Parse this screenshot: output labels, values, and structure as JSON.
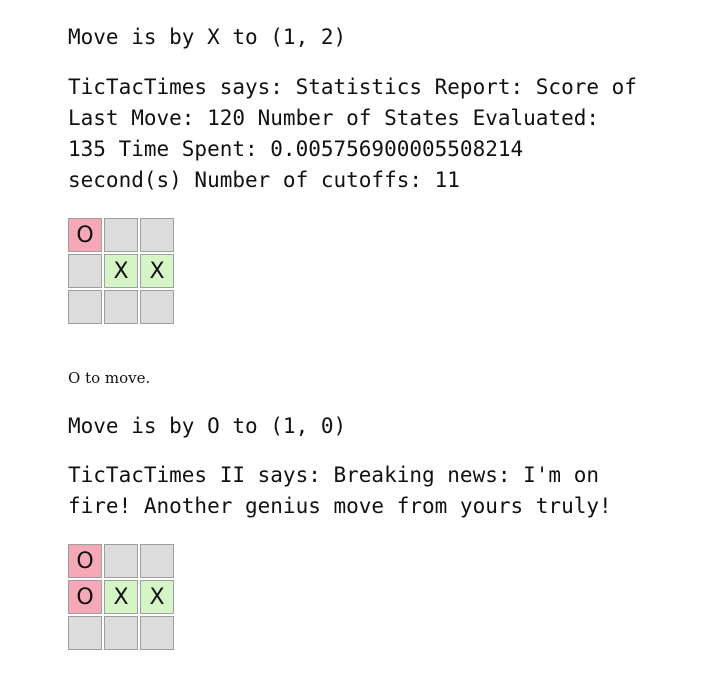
{
  "log": [
    {
      "move": "Move is by X to (1, 2)",
      "says": "TicTacTimes says: Statistics Report: Score of Last Move: 120 Number of States Evaluated: 135 Time Spent: 0.005756900005508214 second(s) Number of cutoffs: 11",
      "board": [
        [
          "O",
          "",
          ""
        ],
        [
          "",
          "X",
          "X"
        ],
        [
          "",
          "",
          ""
        ]
      ]
    },
    {
      "to_move": "O to move.",
      "move": "Move is by O to (1, 0)",
      "says": "TicTacTimes II says: Breaking news: I'm on fire! Another genius move from yours truly!",
      "board": [
        [
          "O",
          "",
          ""
        ],
        [
          "O",
          "X",
          "X"
        ],
        [
          "",
          "",
          ""
        ]
      ]
    }
  ],
  "colors": {
    "o_cell": "#f7a8b8",
    "x_cell": "#d6f5c6",
    "empty_cell": "#dcdcdc"
  }
}
